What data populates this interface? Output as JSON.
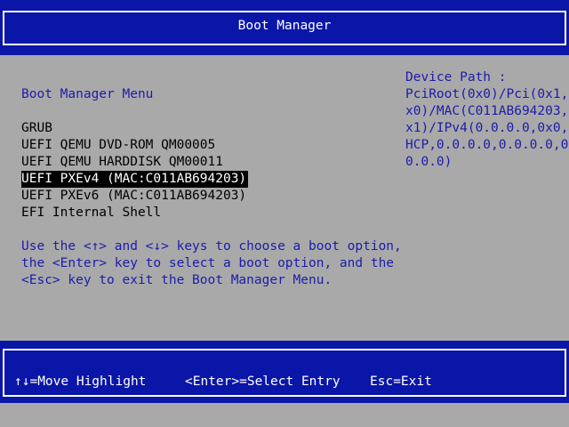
{
  "header": {
    "title": "Boot Manager"
  },
  "menu": {
    "title": "Boot Manager Menu",
    "items": [
      {
        "label": "GRUB"
      },
      {
        "label": "UEFI QEMU DVD-ROM QM00005"
      },
      {
        "label": "UEFI QEMU HARDDISK QM00011"
      },
      {
        "label": "UEFI PXEv4 (MAC:C011AB694203)",
        "selected": true
      },
      {
        "label": "UEFI PXEv6 (MAC:C011AB694203)"
      },
      {
        "label": "EFI Internal Shell"
      }
    ]
  },
  "help": {
    "lines": [
      "Use the <↑> and <↓> keys to choose a boot option,",
      "the <Enter> key to select a boot option, and the",
      "<Esc> key to exit the Boot Manager Menu."
    ]
  },
  "device_path": {
    "lines": [
      "Device Path :",
      "PciRoot(0x0)/Pci(0x1,0",
      "x0)/MAC(C011AB694203,0",
      "x1)/IPv4(0.0.0.0,0x0,D",
      "HCP,0.0.0.0,0.0.0.0,0.",
      "0.0.0)"
    ]
  },
  "footer": {
    "move": "↑↓=Move Highlight",
    "enter": "<Enter>=Select Entry",
    "esc": "Esc=Exit"
  },
  "colors": {
    "background": "#a9a9aa",
    "bar": "#0a16a8",
    "text_blue": "#1c1ca9",
    "highlight": "#000000"
  }
}
